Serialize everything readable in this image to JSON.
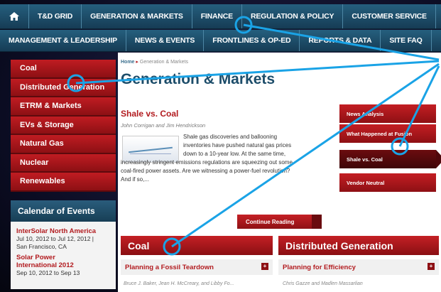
{
  "nav": {
    "row1": [
      "T&D GRID",
      "GENERATION & MARKETS",
      "FINANCE",
      "REGULATION & POLICY",
      "CUSTOMER SERVICE"
    ],
    "row2": [
      "MANAGEMENT & LEADERSHIP",
      "NEWS & EVENTS",
      "FRONTLINES & OP-ED",
      "REPORTS & DATA",
      "SITE FAQ"
    ],
    "home_icon": "home-icon"
  },
  "sidebar": {
    "items": [
      "Coal",
      "Distributed Generation",
      "ETRM & Markets",
      "EVs & Storage",
      "Natural Gas",
      "Nuclear",
      "Renewables"
    ]
  },
  "calendar": {
    "heading": "Calendar of Events",
    "events": [
      {
        "title": "InterSolar North America",
        "line1": "Jul 10, 2012 to Jul 12, 2012 |",
        "line2": "San Francisco, CA"
      },
      {
        "title": "Solar Power",
        "title2": "International 2012",
        "line1": "Sep 10, 2012 to Sep 13"
      }
    ]
  },
  "breadcrumb": {
    "home": "Home",
    "current": "Generation & Markets"
  },
  "page_title": "Generation & Markets",
  "article": {
    "title": "Shale vs. Coal",
    "byline": "John Corrigan and Jim Hendrickson",
    "teaser_lines": [
      "Shale gas discoveries and ballooning",
      "inventories have pushed natural gas prices",
      "down to a 10-year low. At the same time,",
      "increasingly stringent emissions regulations are squeezing out some",
      "coal-fired power assets. Are we witnessing a power-fuel revolution?",
      "And if so,..."
    ],
    "continue_label": "Continue Reading"
  },
  "right_panel": {
    "items": [
      "News Analysis",
      "What Happened at Fusion",
      "Shale vs. Coal",
      "Vendor Neutral"
    ],
    "active": "Shale vs. Coal"
  },
  "sections": [
    {
      "heading": "Coal",
      "sub": "Planning a Fossil Teardown",
      "byline": "Bruce J. Baker, Jean H. McCreary, and Libby Fo..."
    },
    {
      "heading": "Distributed Generation",
      "sub": "Planning for Efficiency",
      "byline": "Chris Gazze and Madlen Massarlian"
    }
  ],
  "colors": {
    "accent_red": "#b21b1f",
    "nav_blue": "#1d4d6a",
    "callout": "#1aa3e6"
  }
}
